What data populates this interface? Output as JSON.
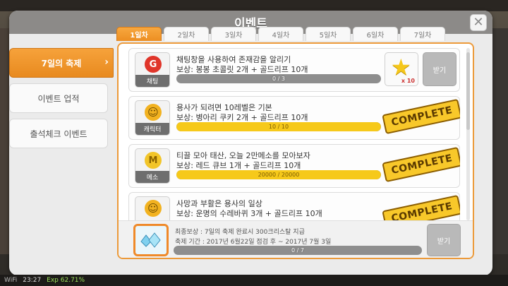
{
  "window": {
    "title": "이벤트"
  },
  "sidebar": {
    "items": [
      {
        "label": "7일의 축제",
        "active": true
      },
      {
        "label": "이벤트 업적",
        "active": false
      },
      {
        "label": "출석체크 이벤트",
        "active": false
      }
    ]
  },
  "tabs": [
    "1일차",
    "2일차",
    "3일차",
    "4일차",
    "5일차",
    "6일차",
    "7일차"
  ],
  "missions": [
    {
      "icon": "chat-icon",
      "icon_char": "G",
      "icon_caption": "채팅",
      "title": "채팅창을 사용하여 존재감을 알리기",
      "reward": "보상: 봉봉 초콜릿 2개 + 골드리프 10개",
      "progress_text": "0 / 3",
      "progress": 0,
      "reward_count": "x 10",
      "button": "받기",
      "complete": false
    },
    {
      "icon": "character-icon",
      "icon_char": "☺",
      "icon_caption": "캐릭터",
      "title": "용사가 되려면 10레벨은 기본",
      "reward": "보상: 병아리 쿠키 2개 + 골드리프 10개",
      "progress_text": "10 / 10",
      "progress": 1,
      "stamp": "COMPLETE",
      "complete": true
    },
    {
      "icon": "meso-icon",
      "icon_char": "M",
      "icon_caption": "메소",
      "title": "티끌 모아 태산, 오늘 2만메소를 모아보자",
      "reward": "보상: 레드 큐브 1개 + 골드리프 10개",
      "progress_text": "20000 / 20000",
      "progress": 1,
      "stamp": "COMPLETE",
      "complete": true
    },
    {
      "icon": "character-icon",
      "icon_char": "☺",
      "icon_caption": "",
      "title": "사망과 부활은 용사의 일상",
      "reward": "보상: 운명의 수레바퀴 3개 + 골드리프 10개",
      "progress_text": "",
      "progress": 1,
      "stamp": "COMPLETE",
      "complete": true
    }
  ],
  "final_reward": {
    "line1": "최종보상 : 7일의 축제 완료시 300크리스탈 지급",
    "line2": "축제 기간 : 2017년 6월22일 점검 후 ~ 2017년 7월 3일",
    "progress_text": "0 / 7",
    "progress": 0,
    "button": "받기"
  },
  "statusbar": {
    "wifi": "WiFi",
    "time": "23:27",
    "exp": "Exp 62.71%"
  },
  "colors": {
    "accent": "#ec8e22",
    "progress": "#f6c91a",
    "panel": "#ebebeb"
  }
}
